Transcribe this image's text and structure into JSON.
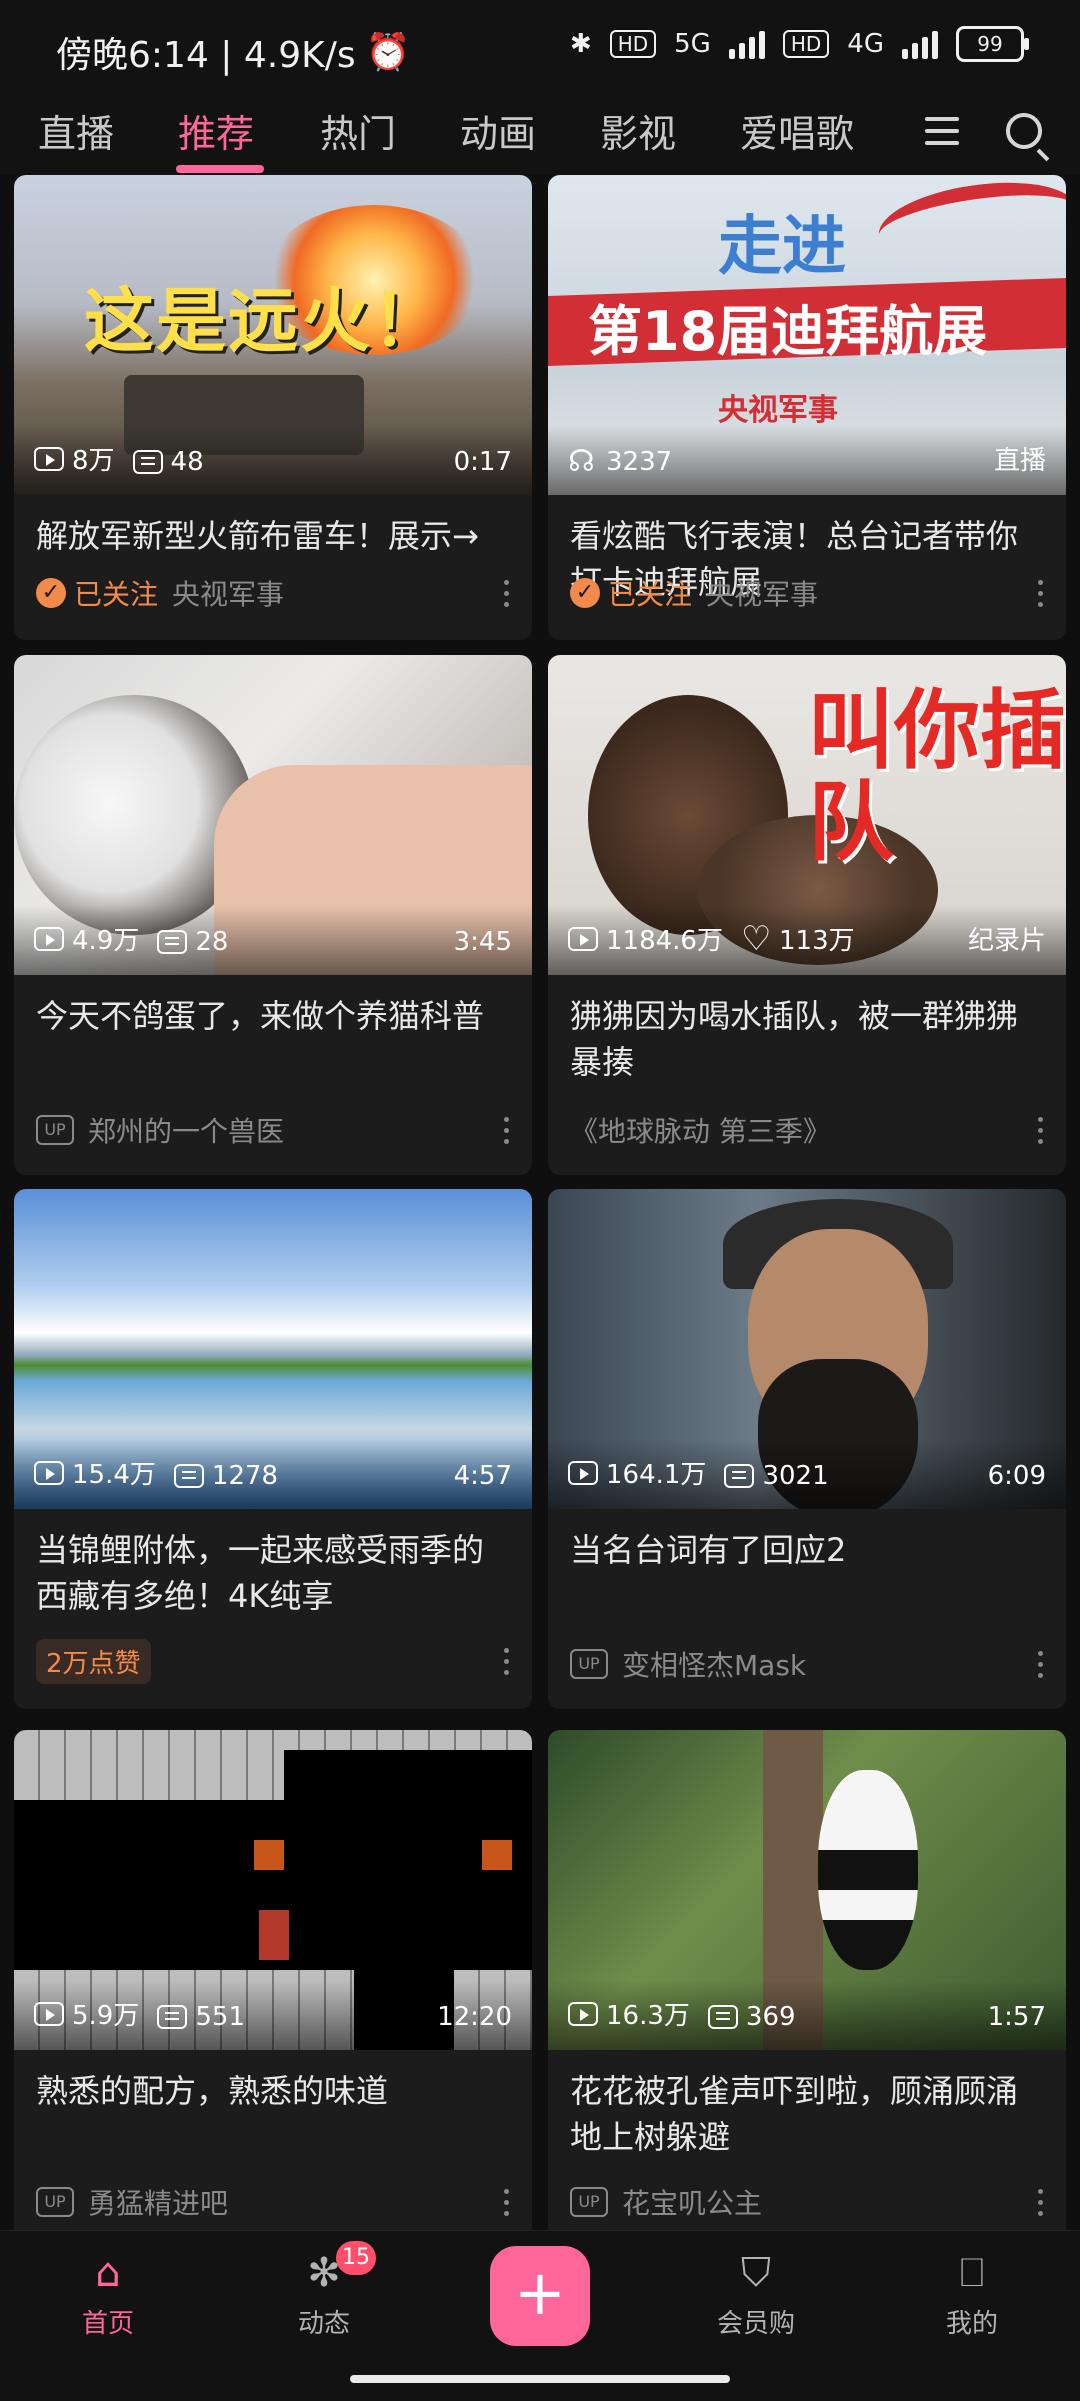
{
  "status_bar": {
    "time_label": "傍晚6:14 | 4.9K/s",
    "alarm_icon": "alarm-icon",
    "bluetooth_icon": "bluetooth-icon",
    "hd1": "HD",
    "net1": "5G",
    "hd2": "HD",
    "net2": "4G",
    "battery": "99"
  },
  "top_nav": {
    "tabs": [
      {
        "label": "直播"
      },
      {
        "label": "推荐",
        "active": true
      },
      {
        "label": "热门"
      },
      {
        "label": "动画"
      },
      {
        "label": "影视"
      },
      {
        "label": "爱唱歌"
      }
    ],
    "menu_icon": "menu-icon",
    "search_icon": "search-icon",
    "accent_color": "#ff6699"
  },
  "cards": [
    {
      "thumb_text": "这是远火！",
      "views": "8万",
      "danmaku": "48",
      "duration": "0:17",
      "title": "解放军新型火箭布雷车！展示→",
      "followed_label": "已关注",
      "author": "央视军事"
    },
    {
      "thumb_text_a": "走进",
      "thumb_text_b": "第18届迪拜航展",
      "thumb_channel": "央视军事",
      "viewers": "3237",
      "badge": "直播",
      "title": "看炫酷飞行表演！总台记者带你打卡迪拜航展",
      "followed_label": "已关注",
      "author": "央视军事"
    },
    {
      "views": "4.9万",
      "danmaku": "28",
      "duration": "3:45",
      "title": "今天不鸽蛋了，来做个养猫科普",
      "up_label": "UP",
      "author": "郑州的一个兽医"
    },
    {
      "thumb_text": "叫你插队",
      "views": "1184.6万",
      "likes": "113万",
      "badge": "纪录片",
      "title": "狒狒因为喝水插队，被一群狒狒暴揍",
      "author": "《地球脉动 第三季》"
    },
    {
      "views": "15.4万",
      "danmaku": "1278",
      "duration": "4:57",
      "title": "当锦鲤附体，一起来感受雨季的西藏有多绝！4K纯享",
      "tag": "2万点赞"
    },
    {
      "views": "164.1万",
      "danmaku": "3021",
      "duration": "6:09",
      "title": "当名台词有了回应2",
      "up_label": "UP",
      "author": "变相怪杰Mask"
    },
    {
      "views": "5.9万",
      "danmaku": "551",
      "duration": "12:20",
      "title": "熟悉的配方，熟悉的味道",
      "up_label": "UP",
      "author": "勇猛精进吧"
    },
    {
      "views": "16.3万",
      "danmaku": "369",
      "duration": "1:57",
      "title": "花花被孔雀声吓到啦，顾涌顾涌地上树躲避",
      "up_label": "UP",
      "author": "花宝叽公主"
    }
  ],
  "bottom_nav": {
    "home_label": "首页",
    "dynamic_label": "动态",
    "dynamic_badge": "15",
    "shop_label": "会员购",
    "me_label": "我的",
    "plus_label": "+"
  }
}
